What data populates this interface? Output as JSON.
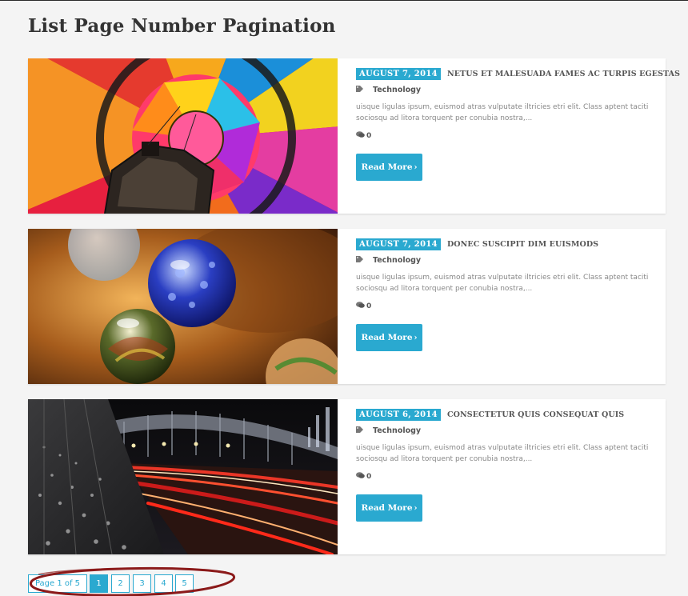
{
  "page": {
    "title": "List Page Number Pagination"
  },
  "posts": [
    {
      "date": "AUGUST 7, 2014",
      "title": "NETUS ET MALESUADA FAMES AC TURPIS EGESTAS",
      "category": "Technology",
      "excerpt": "uisque ligulas ipsum, euismod atras vulputate iltricies etri elit. Class aptent taciti sociosqu ad litora torquent per conubia nostra,...",
      "comments": "0",
      "read_more": "Read More",
      "image": "hot-air-balloon"
    },
    {
      "date": "AUGUST 7, 2014",
      "title": "DONEC SUSCIPIT DIM EUISMODS",
      "category": "Technology",
      "excerpt": "uisque ligulas ipsum, euismod atras vulputate iltricies etri elit. Class aptent taciti sociosqu ad litora torquent per conubia nostra,...",
      "comments": "0",
      "read_more": "Read More",
      "image": "glass-marbles"
    },
    {
      "date": "AUGUST 6, 2014",
      "title": "CONSECTETUR QUIS CONSEQUAT QUIS",
      "category": "Technology",
      "excerpt": "uisque ligulas ipsum, euismod atras vulputate iltricies etri elit. Class aptent taciti sociosqu ad litora torquent per conubia nostra,...",
      "comments": "0",
      "read_more": "Read More",
      "image": "bridge-night-traffic"
    }
  ],
  "pagination": {
    "info": "Page 1 of 5",
    "pages": [
      "1",
      "2",
      "3",
      "4",
      "5"
    ],
    "current": "1"
  },
  "colors": {
    "accent": "#2aa9d0",
    "annotation": "#8b1a1a",
    "background": "#f4f4f4"
  },
  "icons": {
    "tag": "tag-icon",
    "comment": "comment-icon",
    "read_more_chevron": "chevron-right-icon"
  }
}
